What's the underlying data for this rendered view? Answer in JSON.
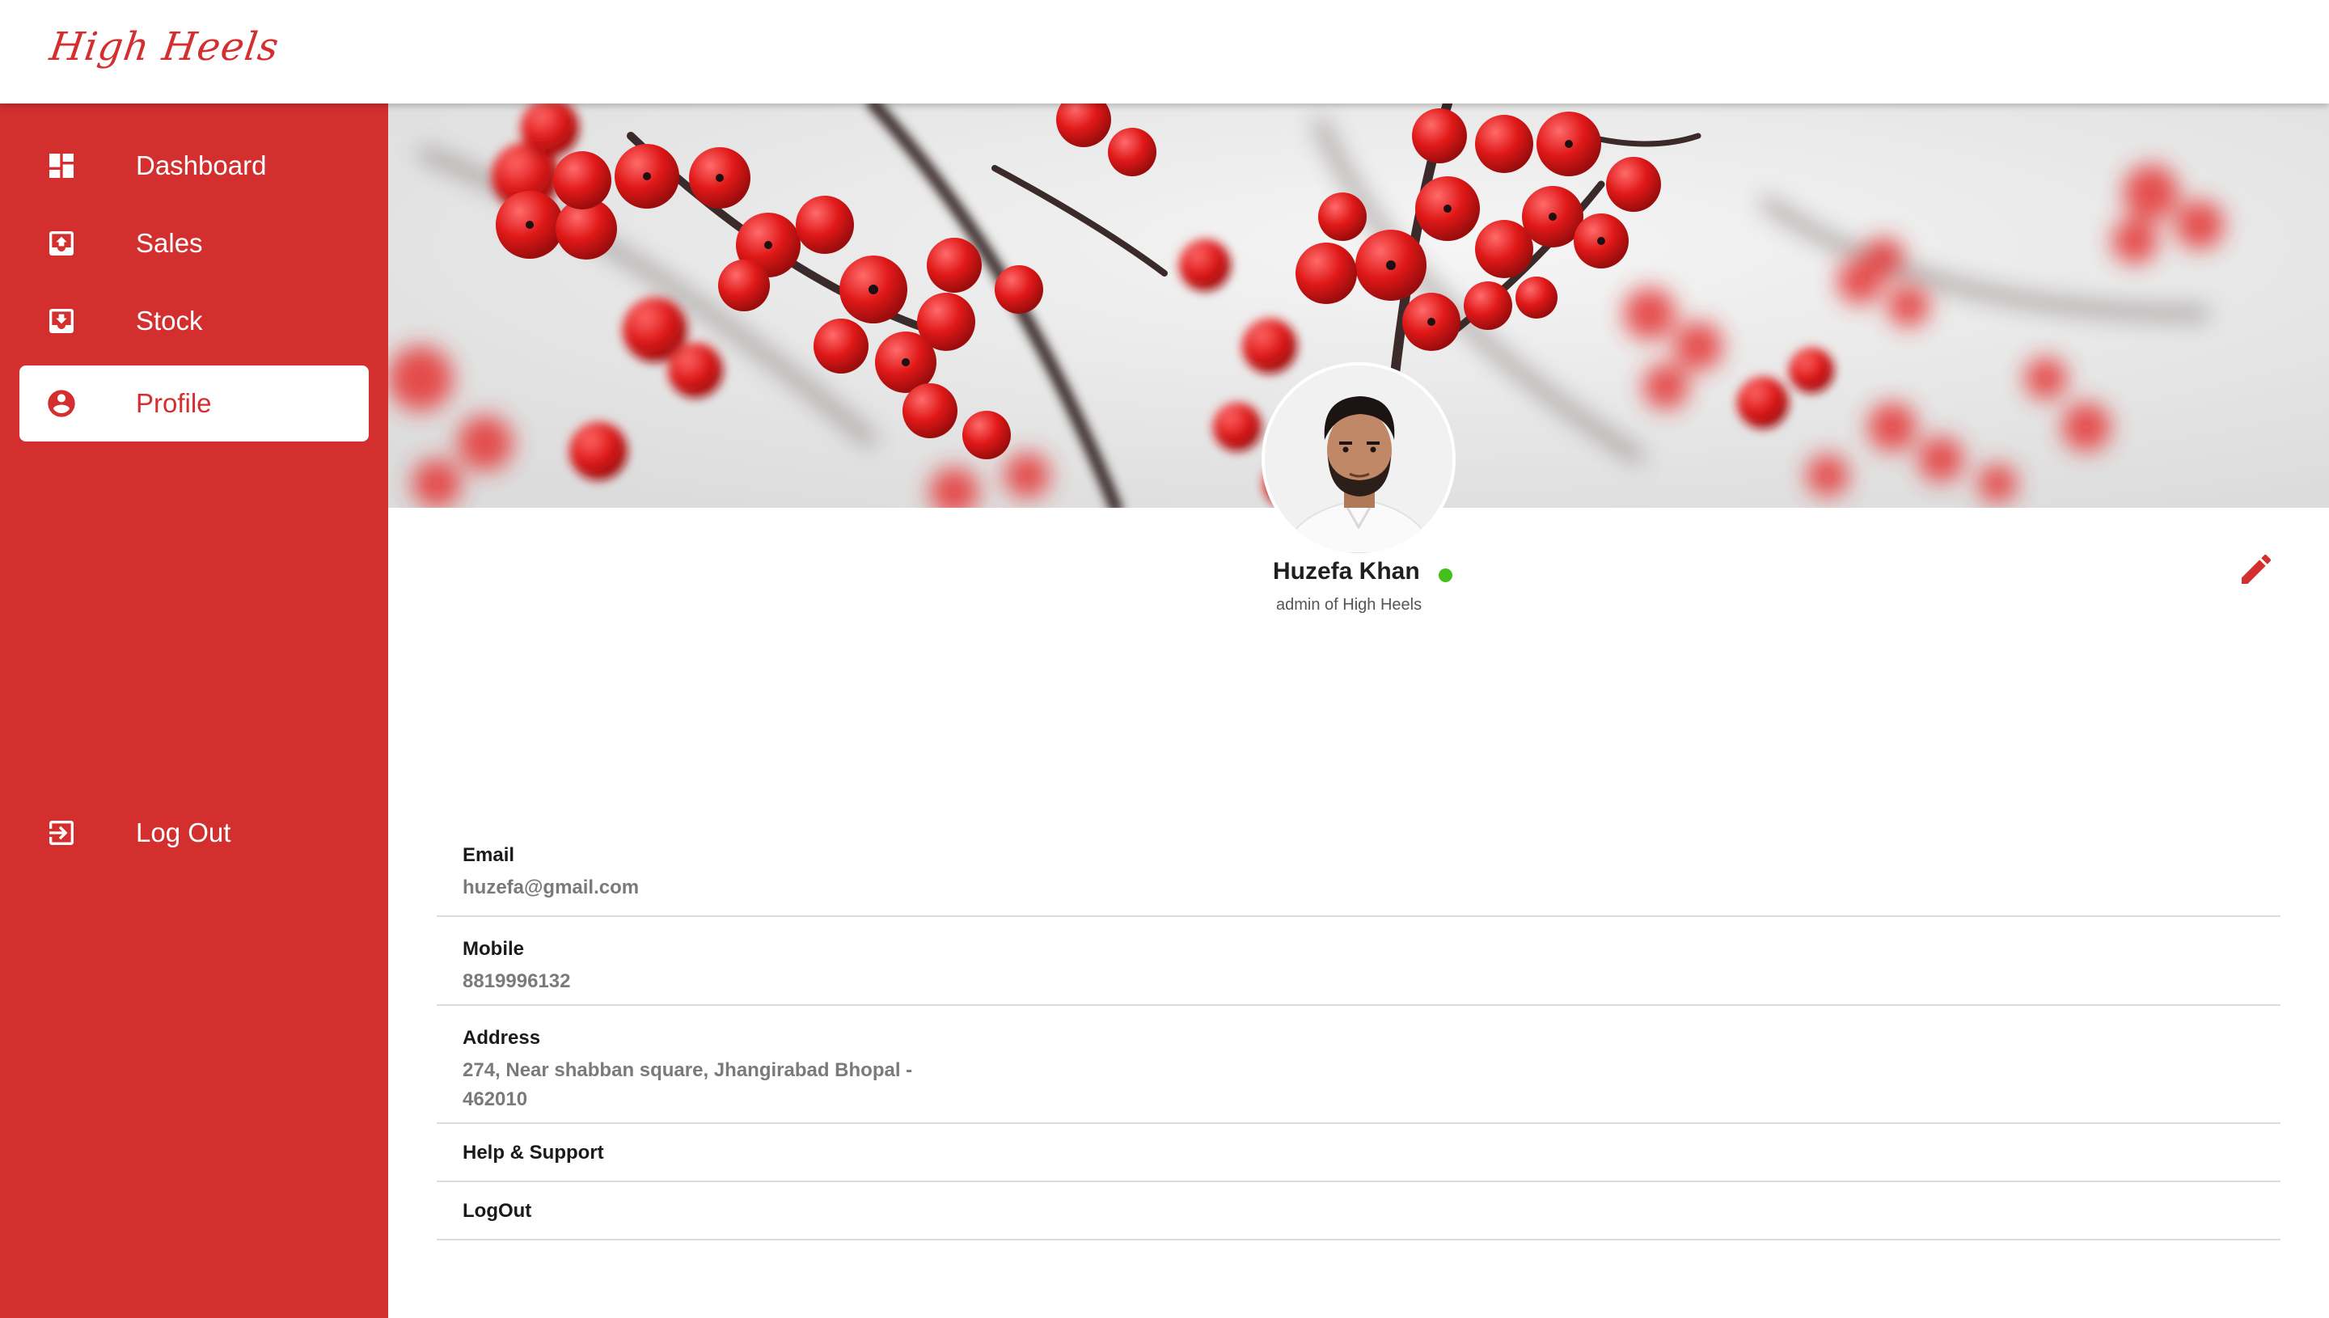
{
  "app": {
    "brand": "High Heels",
    "accent_color": "#d32f2f"
  },
  "sidebar": {
    "items": [
      {
        "label": "Dashboard",
        "icon": "dashboard-icon",
        "active": false
      },
      {
        "label": "Sales",
        "icon": "sales-icon",
        "active": false
      },
      {
        "label": "Stock",
        "icon": "stock-icon",
        "active": false
      },
      {
        "label": "Profile",
        "icon": "account-circle-icon",
        "active": true
      }
    ],
    "logout": {
      "label": "Log Out",
      "icon": "logout-icon"
    }
  },
  "profile": {
    "name": "Huzefa Khan",
    "role": "admin of High Heels",
    "status": "online",
    "status_color": "#43c019",
    "edit_icon": "pencil-icon"
  },
  "details": {
    "email": {
      "label": "Email",
      "value": "huzefa@gmail.com"
    },
    "mobile": {
      "label": "Mobile",
      "value": "8819996132"
    },
    "address": {
      "label": "Address",
      "value": "274, Near shabban square, Jhangirabad Bhopal - 462010"
    },
    "help": {
      "label": "Help & Support"
    },
    "logout": {
      "label": "LogOut"
    }
  }
}
